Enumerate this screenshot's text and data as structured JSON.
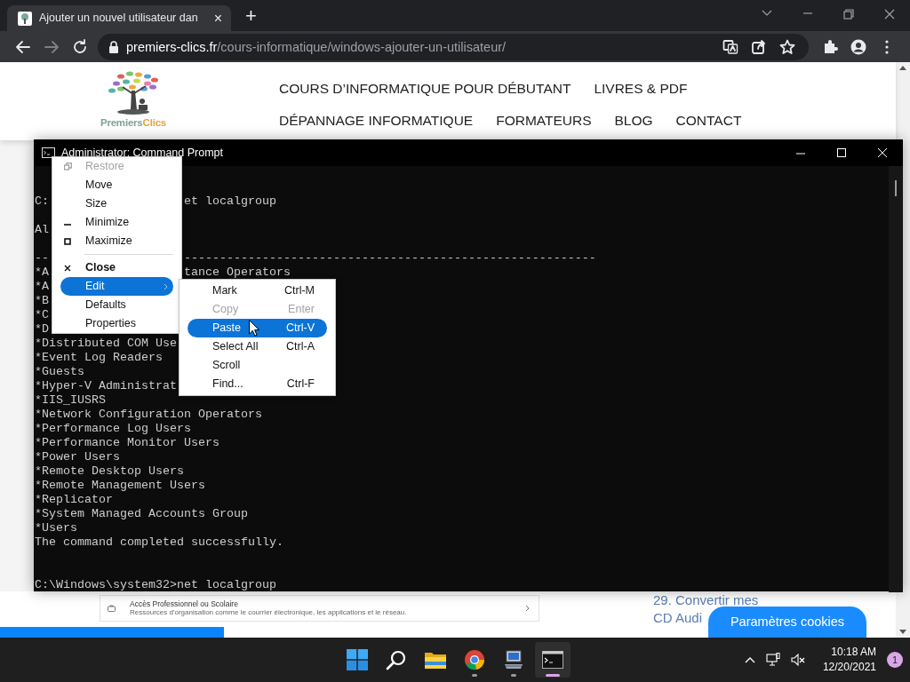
{
  "browser": {
    "tab": {
      "title": "Ajouter un nouvel utilisateur dan",
      "close": "×",
      "selected": true
    },
    "new_tab": "+",
    "url": {
      "domain": "premiers-clics.fr",
      "path": "/cours-informatique/windows-ajouter-un-utilisateur/"
    }
  },
  "website": {
    "logo": {
      "parts": [
        {
          "text": "Premiers",
          "color": "#7fa393"
        },
        {
          "text": "Clics",
          "color": "#e6a243"
        }
      ]
    },
    "nav": [
      [
        "COURS D’INFORMATIQUE POUR DÉBUTANT",
        "LIVRES & PDF"
      ],
      [
        "DÉPANNAGE INFORMATIQUE",
        "FORMATEURS",
        "BLOG",
        "CONTACT"
      ]
    ],
    "embedded_card": {
      "title": "Accès Professionnel ou Scolaire",
      "text": "Ressources d'organisation comme le courrier électronique, les applications et le réseau."
    },
    "side_links": [
      "29. Convertir mes",
      "CD Audi"
    ],
    "cookie_button": "Paramètres cookies"
  },
  "console": {
    "title": "Administrator: Command Prompt",
    "lines": [
      {
        "kind": "text",
        "segments": [
          "C:",
          "et localgroup"
        ]
      },
      {
        "kind": "blank"
      },
      {
        "kind": "text",
        "segments": [
          "Al"
        ]
      },
      {
        "kind": "blank"
      },
      {
        "kind": "text",
        "segments": [
          "--",
          "----------------------------------------------------------"
        ]
      },
      {
        "kind": "text",
        "segments": [
          "*A",
          "tance Operators"
        ]
      },
      {
        "kind": "text",
        "segments": [
          "*A"
        ]
      },
      {
        "kind": "text",
        "segments": [
          "*B"
        ]
      },
      {
        "kind": "text",
        "segments": [
          "*C"
        ]
      },
      {
        "kind": "text",
        "segments": [
          "*D"
        ]
      },
      {
        "kind": "text",
        "segments": [
          "*Distributed COM Use"
        ]
      },
      {
        "kind": "text",
        "segments": [
          "*Event Log Readers"
        ]
      },
      {
        "kind": "text",
        "segments": [
          "*Guests"
        ]
      },
      {
        "kind": "text",
        "segments": [
          "*Hyper-V Administrat"
        ]
      },
      {
        "kind": "text",
        "segments": [
          "*IIS_IUSRS"
        ]
      },
      {
        "kind": "text",
        "segments": [
          "*Network Configuration Operators"
        ]
      },
      {
        "kind": "text",
        "segments": [
          "*Performance Log Users"
        ]
      },
      {
        "kind": "text",
        "segments": [
          "*Performance Monitor Users"
        ]
      },
      {
        "kind": "text",
        "segments": [
          "*Power Users"
        ]
      },
      {
        "kind": "text",
        "segments": [
          "*Remote Desktop Users"
        ]
      },
      {
        "kind": "text",
        "segments": [
          "*Remote Management Users"
        ]
      },
      {
        "kind": "text",
        "segments": [
          "*Replicator"
        ]
      },
      {
        "kind": "text",
        "segments": [
          "*System Managed Accounts Group"
        ]
      },
      {
        "kind": "text",
        "segments": [
          "*Users"
        ]
      },
      {
        "kind": "text",
        "segments": [
          "The command completed successfully."
        ]
      },
      {
        "kind": "blank"
      },
      {
        "kind": "blank"
      },
      {
        "kind": "text",
        "segments": [
          "C:\\Windows\\system32>net localgroup"
        ]
      }
    ]
  },
  "context_menu": [
    {
      "kind": "item",
      "label": "Restore",
      "disabled": true,
      "selected": false,
      "bold": false,
      "submenu": false
    },
    {
      "kind": "item",
      "label": "Move",
      "disabled": false,
      "selected": false,
      "bold": false,
      "submenu": false
    },
    {
      "kind": "item",
      "label": "Size",
      "disabled": false,
      "selected": false,
      "bold": false,
      "submenu": false
    },
    {
      "kind": "item",
      "label": "Minimize",
      "disabled": false,
      "selected": false,
      "bold": false,
      "submenu": false
    },
    {
      "kind": "item",
      "label": "Maximize",
      "disabled": false,
      "selected": false,
      "bold": false,
      "submenu": false
    },
    {
      "kind": "separator"
    },
    {
      "kind": "item",
      "label": "Close",
      "disabled": false,
      "selected": false,
      "bold": true,
      "submenu": false
    },
    {
      "kind": "item",
      "label": "Edit",
      "disabled": false,
      "selected": true,
      "bold": false,
      "submenu": true
    },
    {
      "kind": "item",
      "label": "Defaults",
      "disabled": false,
      "selected": false,
      "bold": false,
      "submenu": false
    },
    {
      "kind": "item",
      "label": "Properties",
      "disabled": false,
      "selected": false,
      "bold": false,
      "submenu": false
    }
  ],
  "edit_submenu": [
    {
      "label": "Mark",
      "shortcut": "Ctrl-M",
      "disabled": false,
      "selected": false
    },
    {
      "label": "Copy",
      "shortcut": "Enter",
      "disabled": true,
      "selected": false
    },
    {
      "label": "Paste",
      "shortcut": "Ctrl-V",
      "disabled": false,
      "selected": true
    },
    {
      "label": "Select All",
      "shortcut": "Ctrl-A",
      "disabled": false,
      "selected": false
    },
    {
      "label": "Scroll",
      "disabled": false,
      "selected": false
    },
    {
      "label": "Find...",
      "shortcut": "Ctrl-F",
      "disabled": false,
      "selected": false
    }
  ],
  "taskbar": {
    "apps": [
      {
        "kind": "start",
        "running": false,
        "selected": false
      },
      {
        "kind": "search",
        "running": false,
        "selected": false
      },
      {
        "kind": "folder",
        "running": false,
        "selected": false
      },
      {
        "kind": "browser",
        "running": true,
        "selected": false
      },
      {
        "kind": "computer",
        "running": true,
        "selected": false
      },
      {
        "kind": "terminal",
        "running": true,
        "selected": true
      }
    ],
    "time": "10:18 AM",
    "date": "12/20/2021",
    "notifications": "1"
  }
}
